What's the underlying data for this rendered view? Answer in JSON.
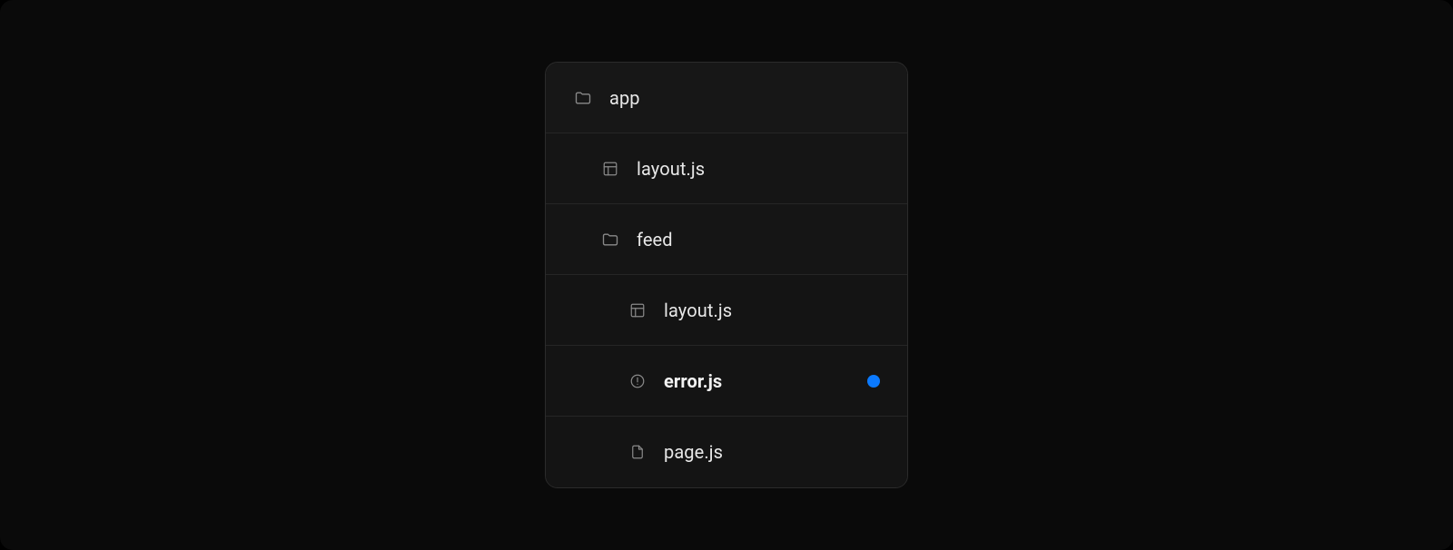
{
  "colors": {
    "accent": "#0b7aff",
    "bg": "#0a0a0a",
    "panel": "#141414",
    "border": "#2b2b2b",
    "text": "#e8e8e8",
    "iconMuted": "#8a8a8a"
  },
  "rows": [
    {
      "depth": 0,
      "icon": "folder",
      "label": "app",
      "bold": false,
      "dot": false
    },
    {
      "depth": 1,
      "icon": "layout",
      "label": "layout.js",
      "bold": false,
      "dot": false
    },
    {
      "depth": 1,
      "icon": "folder",
      "label": "feed",
      "bold": false,
      "dot": false
    },
    {
      "depth": 2,
      "icon": "layout",
      "label": "layout.js",
      "bold": false,
      "dot": false
    },
    {
      "depth": 2,
      "icon": "error",
      "label": "error.js",
      "bold": true,
      "dot": true
    },
    {
      "depth": 2,
      "icon": "file",
      "label": "page.js",
      "bold": false,
      "dot": false
    }
  ]
}
